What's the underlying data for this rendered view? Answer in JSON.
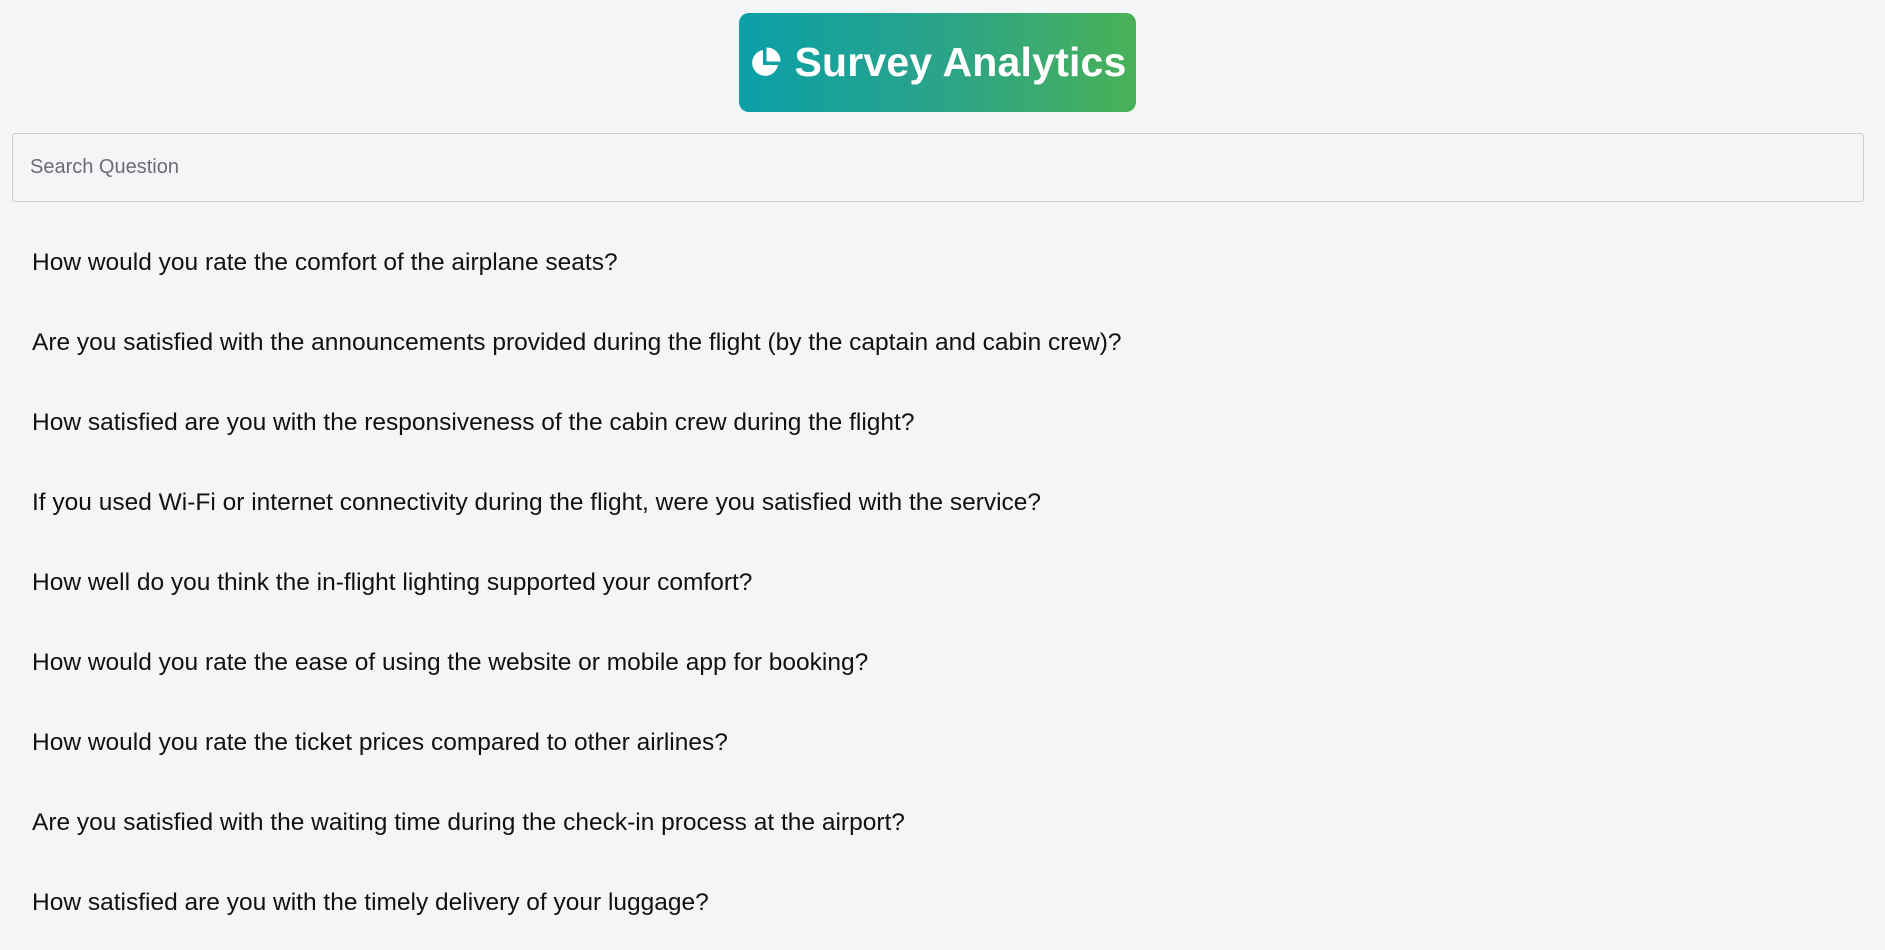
{
  "header": {
    "title": "Survey Analytics",
    "icon": "pie-chart-icon",
    "gradient_start": "#0aa0a8",
    "gradient_end": "#49b157"
  },
  "search": {
    "placeholder": "Search Question",
    "value": ""
  },
  "questions": [
    {
      "text": "How would you rate the comfort of the airplane seats?"
    },
    {
      "text": "Are you satisfied with the announcements provided during the flight (by the captain and cabin crew)?"
    },
    {
      "text": "How satisfied are you with the responsiveness of the cabin crew during the flight?"
    },
    {
      "text": "If you used Wi-Fi or internet connectivity during the flight, were you satisfied with the service?"
    },
    {
      "text": "How well do you think the in-flight lighting supported your comfort?"
    },
    {
      "text": "How would you rate the ease of using the website or mobile app for booking?"
    },
    {
      "text": "How would you rate the ticket prices compared to other airlines?"
    },
    {
      "text": "Are you satisfied with the waiting time during the check-in process at the airport?"
    },
    {
      "text": "How satisfied are you with the timely delivery of your luggage?"
    }
  ]
}
